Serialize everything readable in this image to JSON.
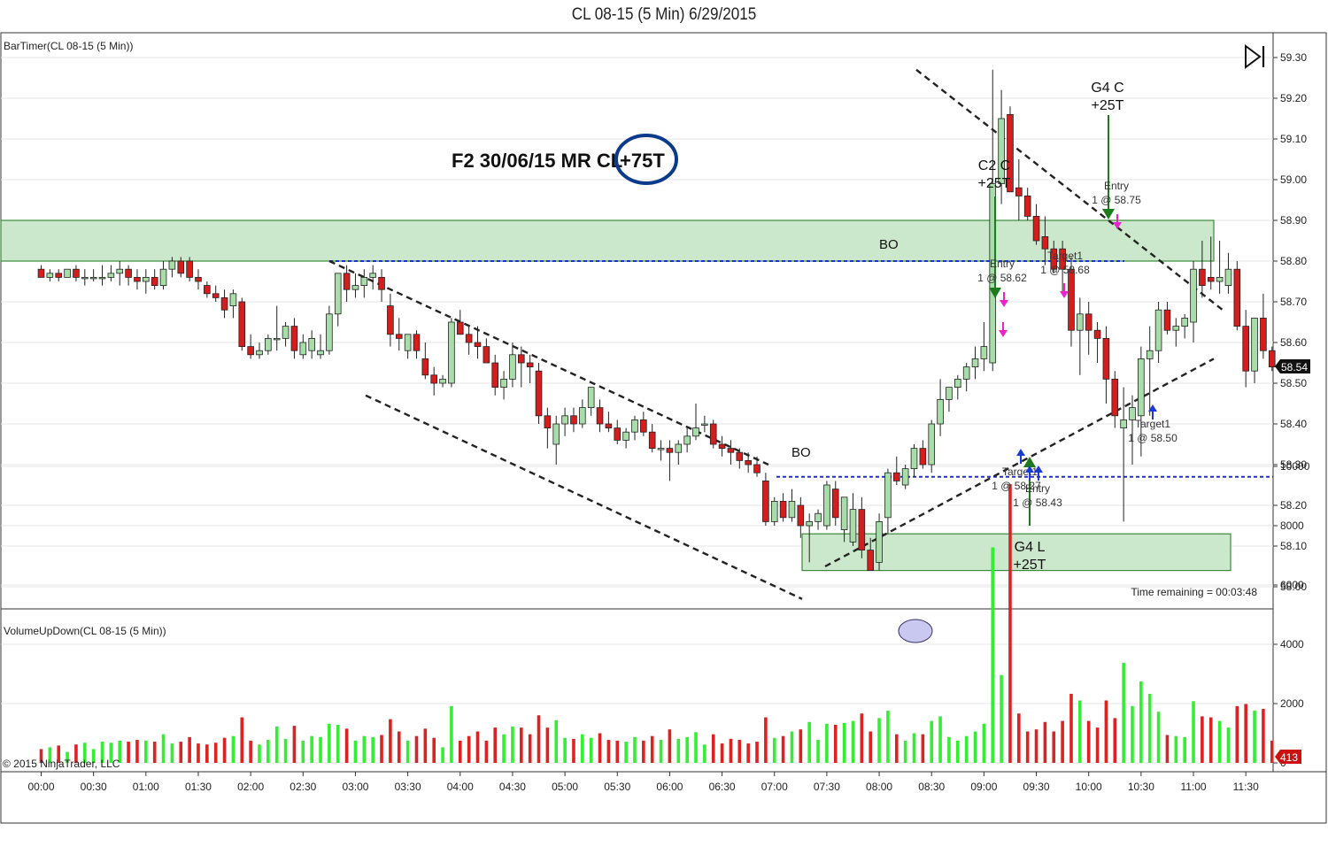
{
  "window": {
    "title": "CL 08-15 (5 Min)  6/29/2015"
  },
  "chart_data": [
    {
      "type": "candlestick",
      "indicator_label": "BarTimer(CL 08-15 (5 Min))",
      "y_ticks": [
        "59.30",
        "59.20",
        "59.10",
        "59.00",
        "58.90",
        "58.80",
        "58.70",
        "58.60",
        "58.50",
        "58.40",
        "58.30",
        "58.20",
        "58.10",
        "58.00"
      ],
      "ylim": [
        57.97,
        59.33
      ],
      "last_price": "58.54",
      "bar_interval_min": 5,
      "first_bar": "00:00",
      "candles": [
        [
          58.78,
          58.79,
          58.76,
          58.76
        ],
        [
          58.76,
          58.78,
          58.75,
          58.77
        ],
        [
          58.77,
          58.78,
          58.75,
          58.76
        ],
        [
          58.76,
          58.78,
          58.76,
          58.78
        ],
        [
          58.78,
          58.79,
          58.75,
          58.76
        ],
        [
          58.76,
          58.78,
          58.74,
          58.76
        ],
        [
          58.76,
          58.78,
          58.75,
          58.76
        ],
        [
          58.76,
          58.79,
          58.74,
          58.76
        ],
        [
          58.76,
          58.79,
          58.75,
          58.77
        ],
        [
          58.77,
          58.8,
          58.74,
          58.78
        ],
        [
          58.78,
          58.79,
          58.74,
          58.76
        ],
        [
          58.76,
          58.78,
          58.73,
          58.75
        ],
        [
          58.75,
          58.78,
          58.72,
          58.76
        ],
        [
          58.76,
          58.78,
          58.73,
          58.74
        ],
        [
          58.74,
          58.8,
          58.73,
          58.78
        ],
        [
          58.78,
          58.81,
          58.76,
          58.8
        ],
        [
          58.8,
          58.81,
          58.76,
          58.77
        ],
        [
          58.8,
          58.81,
          58.75,
          58.76
        ],
        [
          58.76,
          58.78,
          58.73,
          58.75
        ],
        [
          58.74,
          58.75,
          58.71,
          58.72
        ],
        [
          58.72,
          58.74,
          58.7,
          58.71
        ],
        [
          58.71,
          58.73,
          58.66,
          58.68
        ],
        [
          58.69,
          58.73,
          58.66,
          58.72
        ],
        [
          58.7,
          58.71,
          58.58,
          58.59
        ],
        [
          58.59,
          58.62,
          58.56,
          58.57
        ],
        [
          58.57,
          58.6,
          58.56,
          58.58
        ],
        [
          58.58,
          58.62,
          58.57,
          58.61
        ],
        [
          58.61,
          58.69,
          58.58,
          58.61
        ],
        [
          58.61,
          58.65,
          58.59,
          58.64
        ],
        [
          58.64,
          58.66,
          58.56,
          58.58
        ],
        [
          58.57,
          58.62,
          58.56,
          58.6
        ],
        [
          58.58,
          58.63,
          58.56,
          58.61
        ],
        [
          58.57,
          58.62,
          58.56,
          58.58
        ],
        [
          58.58,
          58.69,
          58.57,
          58.67
        ],
        [
          58.67,
          58.75,
          58.64,
          58.77
        ],
        [
          58.77,
          58.79,
          58.7,
          58.73
        ],
        [
          58.73,
          58.77,
          58.71,
          58.74
        ],
        [
          58.74,
          58.78,
          58.71,
          58.76
        ],
        [
          58.76,
          58.79,
          58.73,
          58.77
        ],
        [
          58.76,
          58.78,
          58.7,
          58.73
        ],
        [
          58.69,
          58.72,
          58.59,
          58.62
        ],
        [
          58.62,
          58.66,
          58.58,
          58.61
        ],
        [
          58.58,
          58.62,
          58.56,
          58.62
        ],
        [
          58.62,
          58.63,
          58.56,
          58.58
        ],
        [
          58.56,
          58.6,
          58.51,
          58.52
        ],
        [
          58.52,
          58.54,
          58.47,
          58.5
        ],
        [
          58.5,
          58.52,
          58.49,
          58.51
        ],
        [
          58.5,
          58.66,
          58.49,
          58.65
        ],
        [
          58.65,
          58.68,
          58.62,
          58.62
        ],
        [
          58.62,
          58.64,
          58.57,
          58.6
        ],
        [
          58.6,
          58.64,
          58.56,
          58.59
        ],
        [
          58.59,
          58.61,
          58.55,
          58.55
        ],
        [
          58.55,
          58.57,
          58.47,
          58.49
        ],
        [
          58.49,
          58.53,
          58.46,
          58.51
        ],
        [
          58.51,
          58.6,
          58.49,
          58.57
        ],
        [
          58.57,
          58.59,
          58.49,
          58.55
        ],
        [
          58.55,
          58.57,
          58.5,
          58.54
        ],
        [
          58.53,
          58.55,
          58.4,
          58.42
        ],
        [
          58.42,
          58.44,
          58.34,
          58.39
        ],
        [
          58.35,
          58.42,
          58.3,
          58.4
        ],
        [
          58.4,
          58.44,
          58.37,
          58.42
        ],
        [
          58.42,
          58.44,
          58.38,
          58.4
        ],
        [
          58.4,
          58.46,
          58.39,
          58.44
        ],
        [
          58.44,
          58.49,
          58.42,
          58.49
        ],
        [
          58.44,
          58.46,
          58.38,
          58.4
        ],
        [
          58.4,
          58.43,
          58.38,
          58.39
        ],
        [
          58.39,
          58.41,
          58.35,
          58.36
        ],
        [
          58.36,
          58.39,
          58.34,
          58.38
        ],
        [
          58.38,
          58.42,
          58.36,
          58.41
        ],
        [
          58.41,
          58.43,
          58.37,
          58.38
        ],
        [
          58.38,
          58.4,
          58.33,
          58.34
        ],
        [
          58.34,
          58.36,
          58.31,
          58.34
        ],
        [
          58.34,
          58.36,
          58.26,
          58.33
        ],
        [
          58.33,
          58.36,
          58.3,
          58.35
        ],
        [
          58.35,
          58.39,
          58.33,
          58.37
        ],
        [
          58.37,
          58.45,
          58.36,
          58.39
        ],
        [
          58.4,
          58.42,
          58.38,
          58.4
        ],
        [
          58.4,
          58.41,
          58.34,
          58.35
        ],
        [
          58.35,
          58.37,
          58.32,
          58.34
        ],
        [
          58.34,
          58.36,
          58.3,
          58.33
        ],
        [
          58.33,
          58.34,
          58.29,
          58.31
        ],
        [
          58.31,
          58.33,
          58.28,
          58.3
        ],
        [
          58.3,
          58.32,
          58.27,
          58.28
        ],
        [
          58.26,
          58.28,
          58.15,
          58.16
        ],
        [
          58.16,
          58.22,
          58.15,
          58.21
        ],
        [
          58.21,
          58.23,
          58.16,
          58.17
        ],
        [
          58.17,
          58.24,
          58.16,
          58.21
        ],
        [
          58.2,
          58.22,
          58.12,
          58.15
        ],
        [
          58.15,
          58.18,
          58.06,
          58.16
        ],
        [
          58.16,
          58.19,
          58.14,
          58.18
        ],
        [
          58.15,
          58.26,
          58.14,
          58.25
        ],
        [
          58.24,
          58.26,
          58.15,
          58.17
        ],
        [
          58.14,
          58.22,
          58.11,
          58.22
        ],
        [
          58.11,
          58.23,
          58.1,
          58.19
        ],
        [
          58.19,
          58.22,
          58.07,
          58.09
        ],
        [
          58.09,
          58.12,
          58.04,
          58.04
        ],
        [
          58.06,
          58.18,
          58.04,
          58.16
        ],
        [
          58.17,
          58.29,
          58.13,
          58.28
        ],
        [
          58.28,
          58.32,
          58.25,
          58.26
        ],
        [
          58.25,
          58.3,
          58.24,
          58.29
        ],
        [
          58.29,
          58.35,
          58.27,
          58.34
        ],
        [
          58.34,
          58.36,
          58.29,
          58.3
        ],
        [
          58.3,
          58.41,
          58.28,
          58.4
        ],
        [
          58.4,
          58.51,
          58.37,
          58.46
        ],
        [
          58.46,
          58.49,
          58.43,
          58.49
        ],
        [
          58.49,
          58.52,
          58.46,
          58.51
        ],
        [
          58.51,
          58.55,
          58.48,
          58.54
        ],
        [
          58.54,
          58.59,
          58.51,
          58.56
        ],
        [
          58.56,
          58.65,
          58.53,
          58.59
        ],
        [
          58.55,
          59.27,
          58.53,
          58.99
        ],
        [
          58.99,
          59.22,
          58.94,
          59.15
        ],
        [
          59.16,
          59.18,
          58.98,
          58.97
        ],
        [
          58.98,
          59.05,
          58.9,
          58.96
        ],
        [
          58.96,
          58.98,
          58.9,
          58.91
        ],
        [
          58.91,
          58.94,
          58.84,
          58.85
        ],
        [
          58.86,
          58.91,
          58.79,
          58.83
        ],
        [
          58.83,
          58.85,
          58.77,
          58.78
        ],
        [
          58.83,
          58.85,
          58.72,
          58.78
        ],
        [
          58.78,
          58.81,
          58.59,
          58.63
        ],
        [
          58.63,
          58.71,
          58.52,
          58.67
        ],
        [
          58.67,
          58.7,
          58.57,
          58.63
        ],
        [
          58.63,
          58.65,
          58.55,
          58.61
        ],
        [
          58.61,
          58.64,
          58.45,
          58.51
        ],
        [
          58.51,
          58.53,
          58.39,
          58.42
        ],
        [
          58.39,
          58.49,
          58.16,
          58.41
        ],
        [
          58.41,
          58.47,
          58.3,
          58.44
        ],
        [
          58.42,
          58.59,
          58.32,
          58.56
        ],
        [
          58.56,
          58.64,
          58.42,
          58.58
        ],
        [
          58.58,
          58.7,
          58.55,
          58.68
        ],
        [
          58.68,
          58.7,
          58.62,
          58.63
        ],
        [
          58.63,
          58.66,
          58.59,
          58.64
        ],
        [
          58.64,
          58.67,
          58.61,
          58.66
        ],
        [
          58.65,
          58.8,
          58.6,
          58.78
        ],
        [
          58.78,
          58.85,
          58.71,
          58.74
        ],
        [
          58.76,
          58.86,
          58.73,
          58.75
        ],
        [
          58.75,
          58.85,
          58.72,
          58.76
        ],
        [
          58.74,
          58.82,
          58.72,
          58.78
        ],
        [
          58.78,
          58.8,
          58.63,
          58.64
        ],
        [
          58.64,
          58.68,
          58.49,
          58.53
        ],
        [
          58.53,
          58.66,
          58.5,
          58.66
        ],
        [
          58.66,
          58.72,
          58.56,
          58.58
        ],
        [
          58.58,
          58.59,
          58.53,
          58.54
        ]
      ],
      "annotations": [
        {
          "text": "F2 30/06/15 MR CL",
          "kind": "title"
        },
        {
          "text": "+75T",
          "kind": "circled"
        },
        {
          "text": "BO",
          "kind": "label"
        },
        {
          "text": "BO",
          "kind": "label"
        },
        {
          "text": "C2 C",
          "kind": "trade"
        },
        {
          "text": "+25T",
          "kind": "trade"
        },
        {
          "text": "G4 C",
          "kind": "trade"
        },
        {
          "text": "+25T",
          "kind": "trade"
        },
        {
          "text": "G4 L",
          "kind": "trade"
        },
        {
          "text": "+25T",
          "kind": "trade"
        }
      ],
      "order_labels": [
        {
          "text": "Entry"
        },
        {
          "text": "1 @ 58.62"
        },
        {
          "text": "Target1"
        },
        {
          "text": "1 @ 58.68"
        },
        {
          "text": "Entry"
        },
        {
          "text": "1 @ 58.75"
        },
        {
          "text": "Target1"
        },
        {
          "text": "1 @ 58.50"
        },
        {
          "text": "Target1"
        },
        {
          "text": "1 @ 58.27"
        },
        {
          "text": "Entry"
        },
        {
          "text": "1 @ 58.43"
        }
      ],
      "zones": [
        {
          "from": 58.8,
          "to": 58.9,
          "color": "#cce8cc"
        },
        {
          "from": 58.04,
          "to": 58.13,
          "color": "#cce8cc"
        }
      ],
      "dashed_levels": [
        58.8,
        58.27
      ],
      "time_remaining": "Time remaining = 00:03:48"
    },
    {
      "type": "bar",
      "indicator_label": "VolumeUpDown(CL 08-15 (5 Min))",
      "y_ticks": [
        "10000",
        "8000",
        "6000",
        "4000",
        "2000",
        "0"
      ],
      "ylim": [
        0,
        10000
      ],
      "last_value": "413",
      "up_color": "#33ee33",
      "down_color": "#dd2222"
    }
  ],
  "x_axis": {
    "ticks": [
      "00:00",
      "00:30",
      "01:00",
      "01:30",
      "02:00",
      "02:30",
      "03:00",
      "03:30",
      "04:00",
      "04:30",
      "05:00",
      "05:30",
      "06:00",
      "06:30",
      "07:00",
      "07:30",
      "08:00",
      "08:30",
      "09:00",
      "09:30",
      "10:00",
      "10:30",
      "11:00",
      "11:30"
    ]
  },
  "footer": {
    "copyright": "© 2015 NinjaTrader, LLC"
  },
  "toolbar": {
    "scroll_end_icon": "skip-to-end-icon"
  }
}
